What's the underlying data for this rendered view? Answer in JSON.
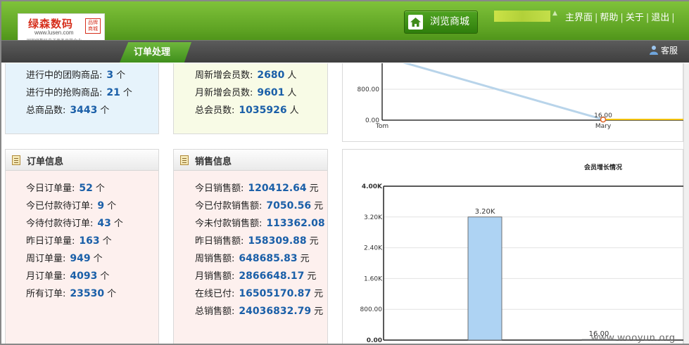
{
  "header": {
    "logo": {
      "name": "绿森数码",
      "url": "www.lusen.com",
      "slogan": "—国家级数码电子商务示范企业—",
      "stamp": "品牌商城"
    },
    "browse_button": "浏览商城",
    "links": [
      "主界面",
      "帮助",
      "关于",
      "退出"
    ],
    "tab": "订单处理",
    "service": "客服"
  },
  "goods_panel": {
    "rows": [
      {
        "label": "进行中的团购商品:",
        "value": "3",
        "unit": "个"
      },
      {
        "label": "进行中的抢购商品:",
        "value": "21",
        "unit": "个"
      },
      {
        "label": "总商品数:",
        "value": "3443",
        "unit": "个"
      }
    ]
  },
  "members_panel": {
    "rows": [
      {
        "label": "周新增会员数:",
        "value": "2680",
        "unit": "人"
      },
      {
        "label": "月新增会员数:",
        "value": "9601",
        "unit": "人"
      },
      {
        "label": "总会员数:",
        "value": "1035926",
        "unit": "人"
      }
    ]
  },
  "orders_panel": {
    "title": "订单信息",
    "rows": [
      {
        "label": "今日订单量:",
        "value": "52",
        "unit": "个"
      },
      {
        "label": "今已付款待订单:",
        "value": "9",
        "unit": "个"
      },
      {
        "label": "今待付款待订单:",
        "value": "43",
        "unit": "个"
      },
      {
        "label": "昨日订单量:",
        "value": "163",
        "unit": "个"
      },
      {
        "label": "周订单量:",
        "value": "949",
        "unit": "个"
      },
      {
        "label": "月订单量:",
        "value": "4093",
        "unit": "个"
      },
      {
        "label": "所有订单:",
        "value": "23530",
        "unit": "个"
      }
    ]
  },
  "sales_panel": {
    "title": "销售信息",
    "rows": [
      {
        "label": "今日销售额:",
        "value": "120412.64",
        "unit": "元"
      },
      {
        "label": "今已付款销售额:",
        "value": "7050.56",
        "unit": "元"
      },
      {
        "label": "今未付款销售额:",
        "value": "113362.08",
        "unit": ""
      },
      {
        "label": "昨日销售额:",
        "value": "158309.88",
        "unit": "元"
      },
      {
        "label": "周销售额:",
        "value": "648685.83",
        "unit": "元"
      },
      {
        "label": "月销售额:",
        "value": "2866648.17",
        "unit": "元"
      },
      {
        "label": "在线已付:",
        "value": "16505170.87",
        "unit": "元"
      },
      {
        "label": "总销售额:",
        "value": "24036832.79",
        "unit": "元"
      }
    ]
  },
  "chart_data": [
    {
      "type": "line",
      "categories": [
        "Tom",
        "Mary"
      ],
      "yticks": [
        "800.00",
        "0.00"
      ],
      "series": [
        {
          "values": [
            1650,
            16
          ],
          "color": "#b8d4ea"
        }
      ],
      "data_labels": [
        "16.00"
      ],
      "ylim": [
        0,
        1200
      ]
    },
    {
      "type": "bar",
      "title": "会员增长情况",
      "yticks": [
        "4.00K",
        "3.20K",
        "2.40K",
        "1.60K",
        "800.00",
        "0.00"
      ],
      "ylim": [
        0,
        4000
      ],
      "values": [
        3200,
        16
      ],
      "data_labels": [
        "3.20K",
        "16.00"
      ],
      "bar_color": "#aed3f3"
    }
  ],
  "watermark": "www.wooyun.org"
}
